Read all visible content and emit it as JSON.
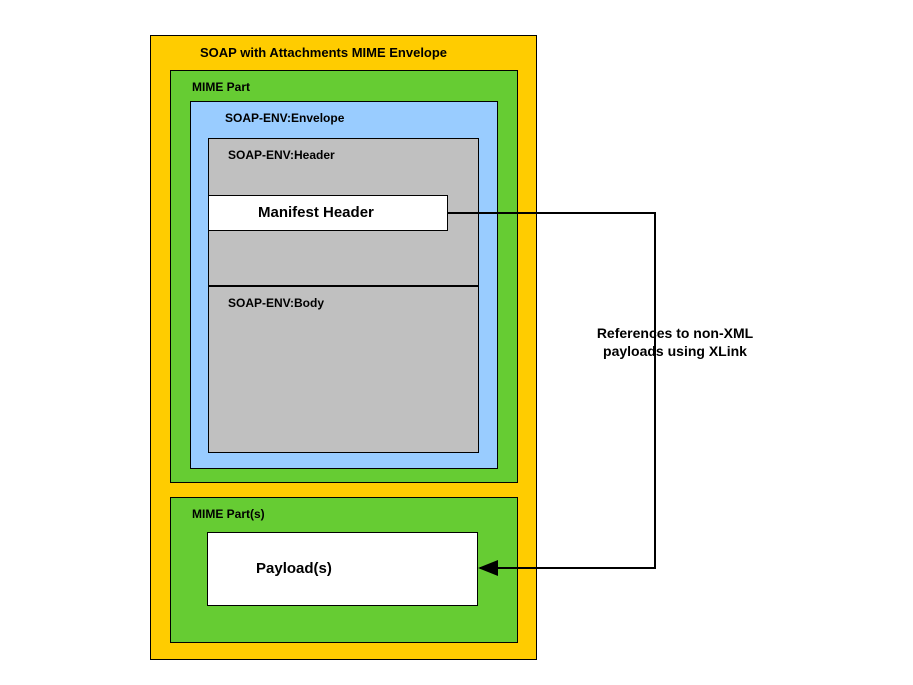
{
  "outer": {
    "title": "SOAP with Attachments MIME Envelope"
  },
  "mime_part_top": {
    "title": "MIME Part"
  },
  "soap_envelope": {
    "title": "SOAP-ENV:Envelope"
  },
  "soap_header": {
    "title": "SOAP-ENV:Header",
    "manifest": "Manifest Header"
  },
  "soap_body": {
    "title": "SOAP-ENV:Body"
  },
  "mime_parts_bottom": {
    "title": "MIME Part(s)",
    "payload": "Payload(s)"
  },
  "annotation": {
    "line1": "References to non-XML",
    "line2": "payloads using XLink"
  }
}
